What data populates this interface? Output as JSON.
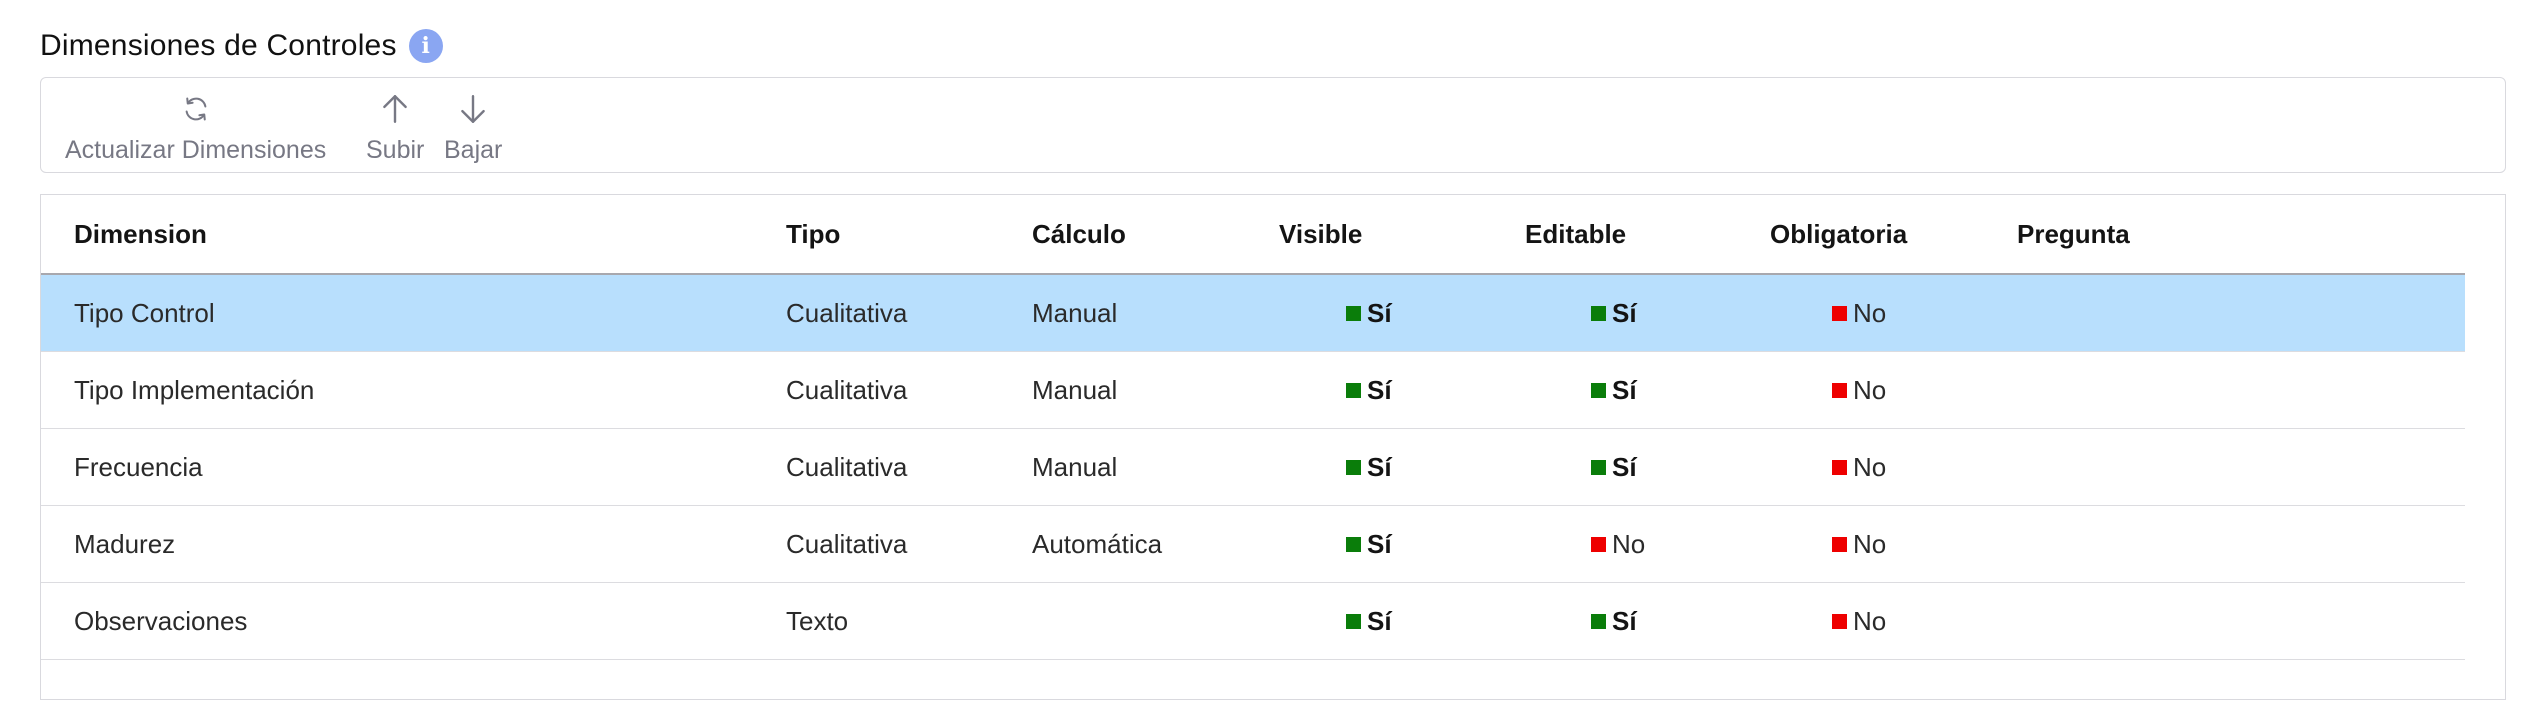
{
  "page": {
    "title": "Dimensiones de Controles",
    "info_icon": "info-icon"
  },
  "toolbar": {
    "refresh_label": "Actualizar Dimensiones",
    "up_label": "Subir",
    "down_label": "Bajar"
  },
  "table": {
    "columns": {
      "dimension": "Dimension",
      "tipo": "Tipo",
      "calculo": "Cálculo",
      "visible": "Visible",
      "editable": "Editable",
      "obligatoria": "Obligatoria",
      "pregunta": "Pregunta"
    },
    "rows": [
      {
        "dimension": "Tipo Control",
        "tipo": "Cualitativa",
        "calculo": "Manual",
        "visible": "Sí",
        "editable": "Sí",
        "obligatoria": "No",
        "pregunta": "",
        "selected": true
      },
      {
        "dimension": "Tipo Implementación",
        "tipo": "Cualitativa",
        "calculo": "Manual",
        "visible": "Sí",
        "editable": "Sí",
        "obligatoria": "No",
        "pregunta": "",
        "selected": false
      },
      {
        "dimension": "Frecuencia",
        "tipo": "Cualitativa",
        "calculo": "Manual",
        "visible": "Sí",
        "editable": "Sí",
        "obligatoria": "No",
        "pregunta": "",
        "selected": false
      },
      {
        "dimension": "Madurez",
        "tipo": "Cualitativa",
        "calculo": "Automática",
        "visible": "Sí",
        "editable": "No",
        "obligatoria": "No",
        "pregunta": "",
        "selected": false
      },
      {
        "dimension": "Observaciones",
        "tipo": "Texto",
        "calculo": "",
        "visible": "Sí",
        "editable": "Sí",
        "obligatoria": "No",
        "pregunta": "",
        "selected": false
      }
    ]
  },
  "colors": {
    "selected_row": "#b8dffd",
    "yes_marker": "#0a7d0a",
    "no_marker": "#ee0000",
    "info_icon": "#8aa6f2",
    "toolbar_text": "#777884"
  }
}
